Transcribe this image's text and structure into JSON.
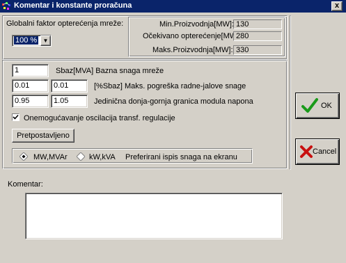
{
  "window": {
    "title": "Komentar i konstante proračuna",
    "close_label": "x"
  },
  "global": {
    "label": "Globalni faktor opterećenja mreže:",
    "factor_value": "100 %"
  },
  "readouts": [
    {
      "label": "Min.Proizvodnja[MW]:",
      "value": "130"
    },
    {
      "label": "Očekivano opterećenje[MW]:",
      "value": "280"
    },
    {
      "label": "Maks.Proizvodnja[MW]:",
      "value": "330"
    }
  ],
  "params": {
    "sbaz_value": "1",
    "sbaz_label": "Sbaz[MVA]  Bazna snaga mreže",
    "err_active": "0.01",
    "err_reactive": "0.01",
    "err_label": "[%Sbaz] Maks. pogreška radne-jalove snage",
    "v_low": "0.95",
    "v_high": "1.05",
    "v_label": "Jedinična donja-gornja granica modula napona",
    "osc_label": "Onemogućavanje oscilacija transf. regulacije",
    "osc_checked": true,
    "default_button": "Pretpostavljeno"
  },
  "units": {
    "opt1": "MW,MVAr",
    "opt2": "kW,kVA",
    "selected": "MW,MVAr",
    "label": "Preferirani ispis snaga na ekranu"
  },
  "comment": {
    "label": "Komentar:",
    "value": ""
  },
  "buttons": {
    "ok": "OK",
    "cancel": "Cancel"
  },
  "colors": {
    "titlebar": "#0a246a",
    "face": "#d4d0c8",
    "ok_check": "#1a9a1a",
    "cancel_x": "#c81010"
  }
}
